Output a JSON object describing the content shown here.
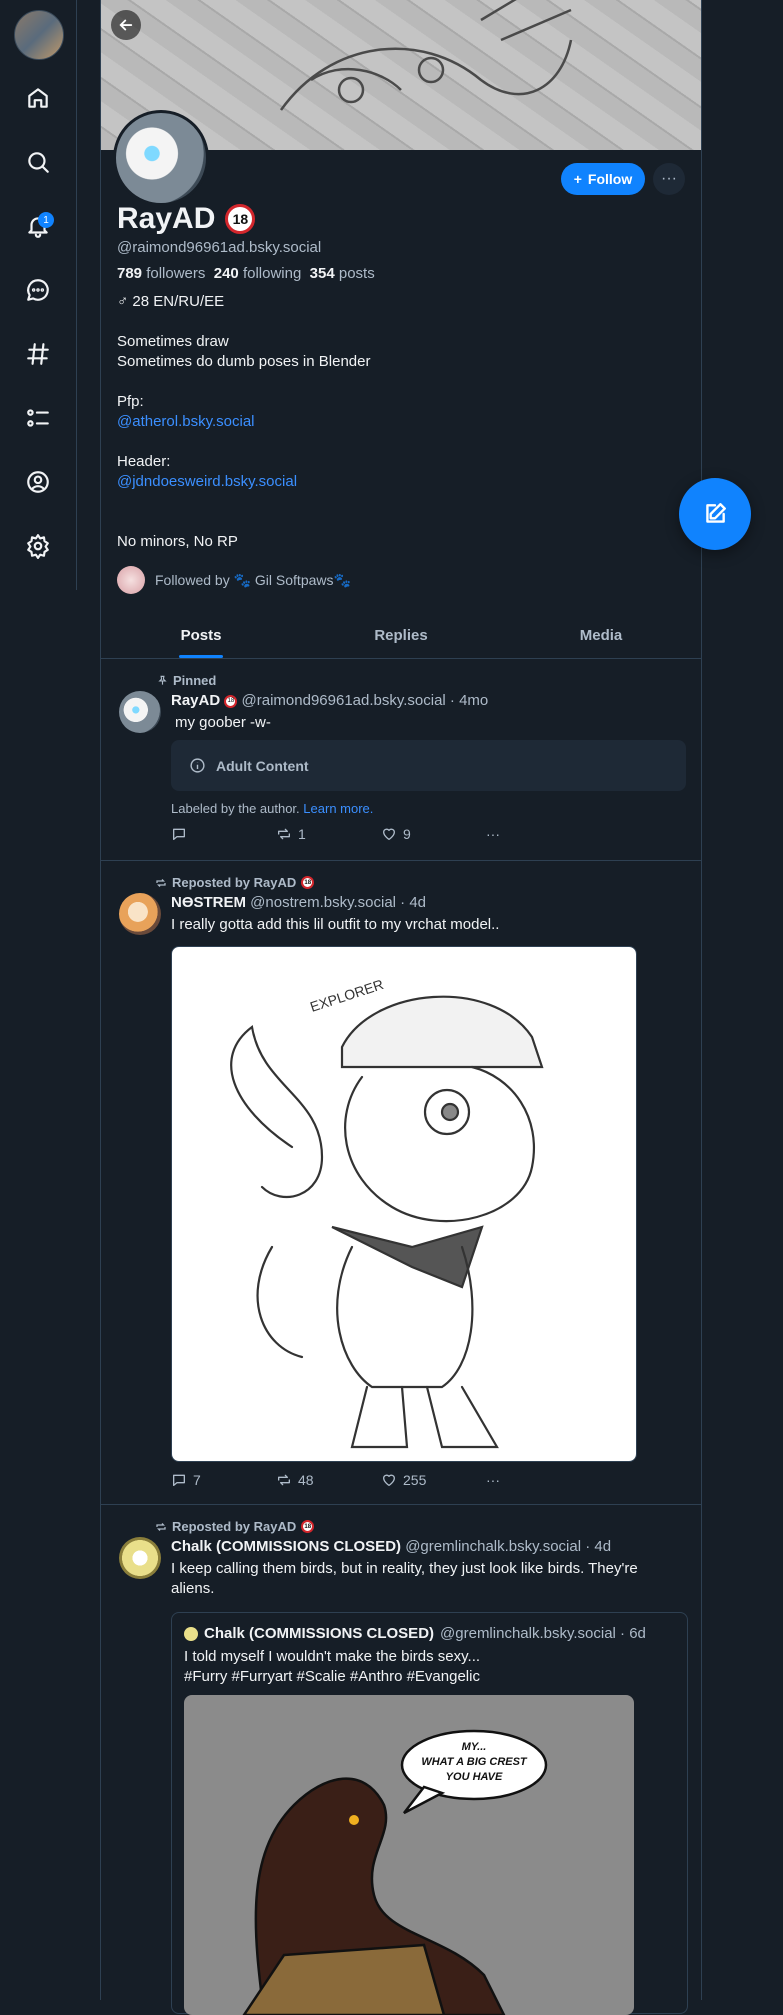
{
  "profile": {
    "name": "RayAD",
    "age_badge": "18",
    "handle": "@raimond96961ad.bsky.social",
    "followers_count": "789",
    "followers_label": "followers",
    "following_count": "240",
    "following_label": "following",
    "posts_count": "354",
    "posts_label": "posts",
    "gender_line": "♂ 28 EN/RU/EE",
    "bio": {
      "line1": "Sometimes draw",
      "line2": "Sometimes do dumb poses in Blender",
      "pfp_label": "Pfp:",
      "pfp_link": "@atherol.bsky.social",
      "header_label": "Header:",
      "header_link": "@jdndoesweird.bsky.social",
      "line_last": "No minors, No RP"
    },
    "follow_label": "Follow",
    "more_label": "···",
    "followed_by": "Followed by 🐾 Gil Softpaws🐾"
  },
  "notifications_badge": "1",
  "tabs": [
    "Posts",
    "Replies",
    "Media"
  ],
  "posts": [
    {
      "top_label": "Pinned",
      "author": "RayAD",
      "handle_time": "@raimond96961ad.bsky.social · 4mo",
      "text": "my goober -w-",
      "content_warning": "Adult Content",
      "labeled_text": "Labeled by the author.",
      "learn_more": "Learn more.",
      "replies": "",
      "reposts": "1",
      "likes": "9"
    },
    {
      "top_label": "Reposted by RayAD",
      "author": "NӨSTREM",
      "handle_time": "@nostrem.bsky.social · 4d",
      "text": "I really gotta add this lil outfit to my vrchat model..",
      "image_caption": "EXPLORER",
      "replies": "7",
      "reposts": "48",
      "likes": "255"
    },
    {
      "top_label": "Reposted by RayAD",
      "author": "Chalk (COMMISSIONS CLOSED)",
      "handle_time": "@gremlinchalk.bsky.social · 4d",
      "text_line1": "I keep calling them birds, but in reality, they just look like birds. They're",
      "text_line2": "aliens.",
      "quote": {
        "author": "Chalk (COMMISSIONS CLOSED)",
        "handle_time": "@gremlinchalk.bsky.social · 6d",
        "text_line1": "I told myself I wouldn't make the birds sexy...",
        "text_line2": "#Furry #Furryart #Scalie #Anthro #Evangelic",
        "bubble": [
          "MY...",
          "WHAT A BIG CREST",
          "YOU HAVE"
        ]
      }
    }
  ]
}
